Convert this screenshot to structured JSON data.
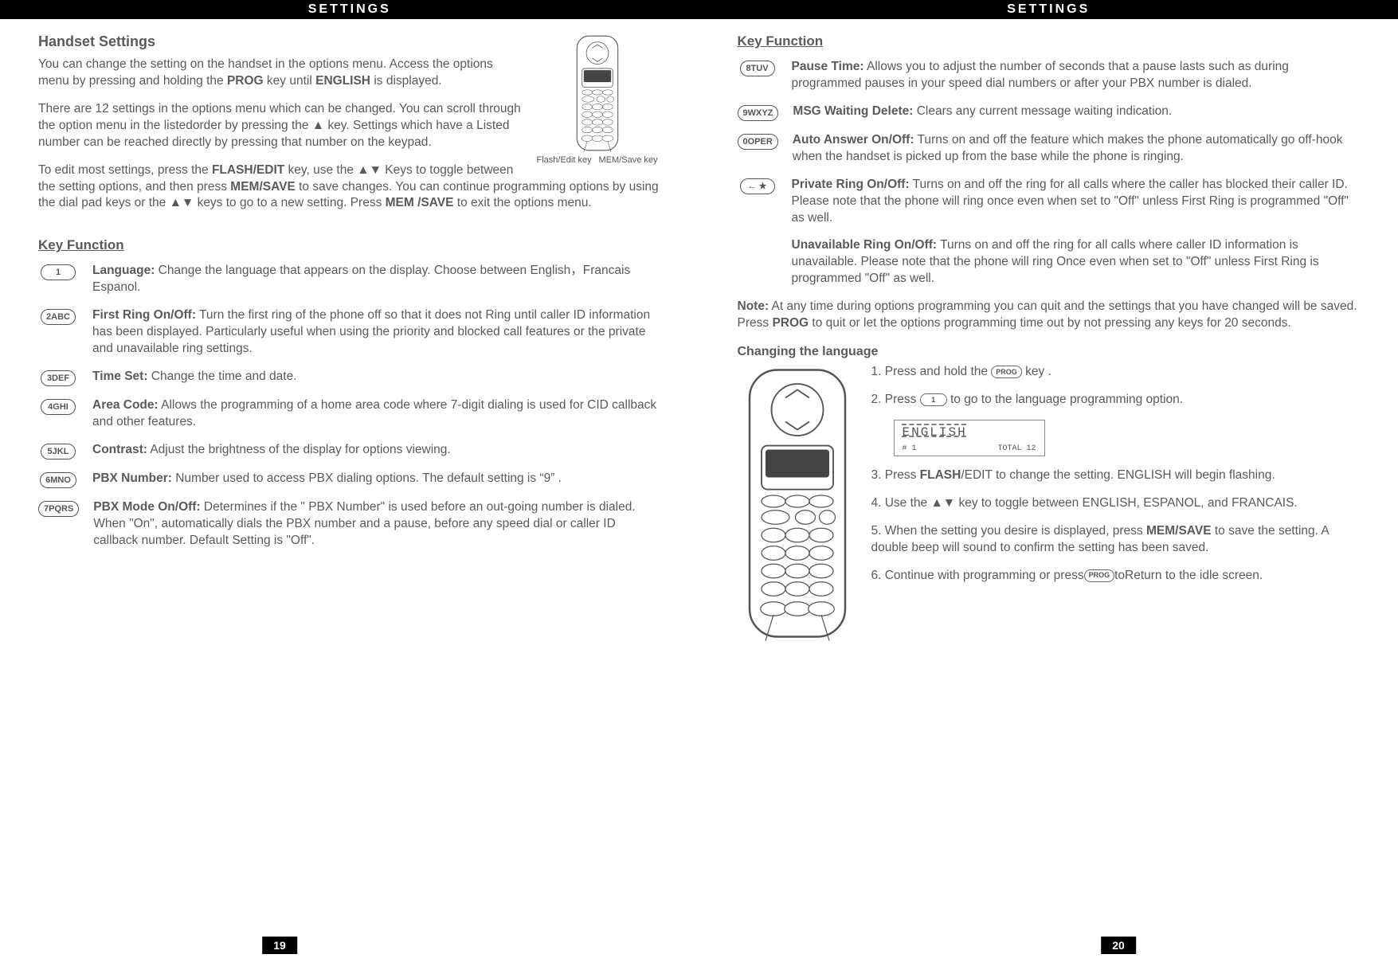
{
  "header": {
    "title": "SETTINGS"
  },
  "page_left": {
    "num": "19",
    "h1": "Handset Settings",
    "intro1_a": "You can change the setting on the handset in the options menu. Access the options menu by pressing and holding the ",
    "intro1_prog": "PROG",
    "intro1_b": " key until   ",
    "intro1_eng": "ENGLISH",
    "intro1_c": "  is displayed.",
    "intro2": "There are 12 settings in the options menu which can be changed. You can scroll through the option menu in the listedorder by pressing the  ▲  key. Settings which have a Listed  number can be reached directly by pressing  that number  on  the  keypad.",
    "intro3_a": "To edit most settings, press the ",
    "intro3_flash": "FLASH/EDIT",
    "intro3_b": " key, use the ▲▼   Keys to toggle between the setting options, and then press ",
    "intro3_mem": "MEM/SAVE",
    "intro3_c": " to save changes. You can continue programming options by using the dial pad keys or the ▲▼   keys to go to a new setting. Press  ",
    "intro3_mem2": "MEM",
    "intro3_save": " /SAVE",
    "intro3_d": " to exit the options menu.",
    "handset_label_left": "Flash/Edit key",
    "handset_label_right": "MEM/Save key",
    "keyfunc_head": "Key Function",
    "items": [
      {
        "badge": "1",
        "title": "Language:",
        "body": " Change the language that appears on the display. Choose between English，Francais Espanol."
      },
      {
        "badge": "2ABC",
        "title": "First Ring On/Off:",
        "body": " Turn the first ring of the phone off so that it does not Ring until caller ID information has been displayed. Particularly useful when using the priority and blocked call features or the private and unavailable ring settings."
      },
      {
        "badge": "3DEF",
        "title": "Time Set:",
        "body": " Change the time and date."
      },
      {
        "badge": "4GHI",
        "title": "Area Code:",
        "body": " Allows the programming of a home area code where 7-digit dialing is used for CID callback and other features."
      },
      {
        "badge": "5JKL",
        "title": "Contrast:",
        "body": " Adjust the brightness of the display for options viewing."
      },
      {
        "badge": "6MNO",
        "title": "PBX Number:",
        "body": " Number used to access PBX dialing options. The default setting is   “9” ."
      },
      {
        "badge": "7PQRS",
        "title": "PBX Mode On/Off:",
        "body": " Determines if the \" PBX Number\"  is used before an out-going number is dialed. When \"On\",  automatically dials the PBX number and a pause, before any speed dial or caller ID callback number. Default Setting is  \"Off\"."
      }
    ]
  },
  "page_right": {
    "num": "20",
    "keyfunc_head": "Key Function",
    "items": [
      {
        "badge": "8TUV",
        "title": "Pause Time:",
        "body": " Allows you to adjust the number of seconds that a pause lasts such as during programmed pauses in your speed dial numbers or after your PBX number is dialed."
      },
      {
        "badge": "9WXYZ",
        "title": "MSG Waiting Delete:",
        "body": " Clears any current message waiting indication."
      },
      {
        "badge": "0OPER",
        "title": "Auto Answer On/Off:",
        "body": " Turns on and off the feature which makes the  phone automatically go off-hook when the handset is picked up from  the base while the phone is ringing."
      },
      {
        "badge": "← ★",
        "title": "Private Ring On/Off:",
        "body": " Turns on and off the ring for all calls where the caller has blocked their caller ID. Please note that the phone will ring once even when set to \"Off\" unless First Ring is programmed \"Off\" as well."
      },
      {
        "badge": "",
        "title": "Unavailable Ring On/Off:",
        "body": " Turns on and off the ring for all calls where caller ID information is unavailable. Please note that the phone will ring Once even when set to \"Off\" unless First Ring is programmed \"Off\" as well."
      }
    ],
    "note_label": "Note:",
    "note_a": " At any time during options programming you can quit and the settings that you have changed will be saved. Press ",
    "note_prog": "PROG",
    "note_b": " to quit or let the options programming time out by not pressing any keys for 20 seconds.",
    "changing_head": "Changing the language",
    "step1_a": "1. Press and hold the ",
    "step1_badge": "PROG",
    "step1_b": " key .",
    "step2_a": "2. Press ",
    "step2_badge": "1",
    "step2_b": " to go to the language programming option.",
    "display_text": "ENGLISH",
    "display_hash": "# 1",
    "display_total": "TOTAL 12",
    "step3_a": "3. Press",
    "step3_flash": "FLASH",
    "step3_b": "/EDIT to change the setting. ENGLISH will begin flashing.",
    "step4": "4. Use the  ▲▼  key to toggle between ENGLISH, ESPANOL, and FRANCAIS.",
    "step5_a": "5. When the setting you  desire  is  displayed,  press ",
    "step5_mem": "MEM/SAVE",
    "step5_b": " to save the setting. A double beep will sound to confirm the setting has been saved.",
    "step6_a": "6. Continue with programming or press",
    "step6_badge": "PROG",
    "step6_b": "toReturn to the idle screen."
  }
}
